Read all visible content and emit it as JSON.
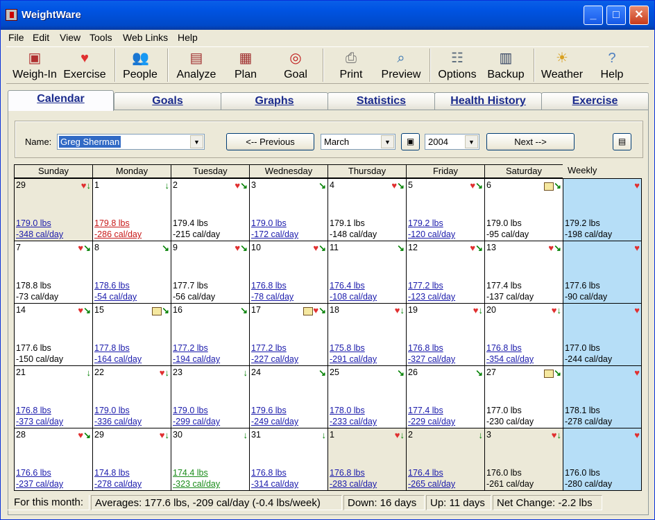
{
  "window": {
    "title": "WeightWare"
  },
  "menu": [
    "File",
    "Edit",
    "View",
    "Tools",
    "Web Links",
    "Help"
  ],
  "toolbar": [
    {
      "label": "Weigh-In",
      "icon": "scale-icon"
    },
    {
      "label": "Exercise",
      "icon": "heart-check-icon"
    },
    {
      "label": "People",
      "icon": "people-icon"
    },
    {
      "label": "Analyze",
      "icon": "analyze-icon"
    },
    {
      "label": "Plan",
      "icon": "plan-icon"
    },
    {
      "label": "Goal",
      "icon": "target-icon"
    },
    {
      "label": "Print",
      "icon": "printer-icon"
    },
    {
      "label": "Preview",
      "icon": "magnifier-icon"
    },
    {
      "label": "Options",
      "icon": "options-icon"
    },
    {
      "label": "Backup",
      "icon": "backup-icon"
    },
    {
      "label": "Weather",
      "icon": "sun-icon"
    },
    {
      "label": "Help",
      "icon": "help-icon"
    }
  ],
  "tabs": [
    "Calendar",
    "Goals",
    "Graphs",
    "Statistics",
    "Health History",
    "Exercise"
  ],
  "controls": {
    "name_label": "Name:",
    "name_value": "Greg Sherman",
    "prev_label": "<-- Previous",
    "month": "March",
    "year": "2004",
    "next_label": "Next -->"
  },
  "weekdays": [
    "Sunday",
    "Monday",
    "Tuesday",
    "Wednesday",
    "Thursday",
    "Friday",
    "Saturday",
    "Weekly"
  ],
  "weeks": [
    [
      {
        "day": "29",
        "weight": "179.0 lbs",
        "cal": "-348 cal/day",
        "style": "link",
        "other": true,
        "icons": [
          "heart",
          "down"
        ]
      },
      {
        "day": "1",
        "weight": "179.8 lbs",
        "cal": "-286 cal/day",
        "style": "red",
        "other": false,
        "icons": [
          "down"
        ]
      },
      {
        "day": "2",
        "weight": "179.4 lbs",
        "cal": "-215 cal/day",
        "style": "plain",
        "other": false,
        "icons": [
          "heart",
          "diag"
        ]
      },
      {
        "day": "3",
        "weight": "179.0 lbs",
        "cal": "-172 cal/day",
        "style": "link",
        "other": false,
        "icons": [
          "diag"
        ]
      },
      {
        "day": "4",
        "weight": "179.1 lbs",
        "cal": "-148 cal/day",
        "style": "plain",
        "other": false,
        "icons": [
          "heart",
          "diag"
        ]
      },
      {
        "day": "5",
        "weight": "179.2 lbs",
        "cal": "-120 cal/day",
        "style": "link",
        "other": false,
        "icons": [
          "heart",
          "diag"
        ]
      },
      {
        "day": "6",
        "weight": "179.0 lbs",
        "cal": "-95 cal/day",
        "style": "plain",
        "other": false,
        "icons": [
          "note",
          "diag"
        ]
      },
      {
        "weight": "179.2 lbs",
        "cal": "-198 cal/day",
        "weekly": true,
        "icons": [
          "heart"
        ]
      }
    ],
    [
      {
        "day": "7",
        "weight": "178.8 lbs",
        "cal": "-73 cal/day",
        "style": "plain",
        "other": false,
        "icons": [
          "heart",
          "diag"
        ]
      },
      {
        "day": "8",
        "weight": "178.6 lbs",
        "cal": "-54 cal/day",
        "style": "link",
        "other": false,
        "icons": [
          "diag"
        ]
      },
      {
        "day": "9",
        "weight": "177.7 lbs",
        "cal": "-56 cal/day",
        "style": "plain",
        "other": false,
        "icons": [
          "heart",
          "diag"
        ]
      },
      {
        "day": "10",
        "weight": "176.8 lbs",
        "cal": "-78 cal/day",
        "style": "link",
        "other": false,
        "icons": [
          "heart",
          "diag"
        ]
      },
      {
        "day": "11",
        "weight": "176.4 lbs",
        "cal": "-108 cal/day",
        "style": "link",
        "other": false,
        "icons": [
          "diag"
        ]
      },
      {
        "day": "12",
        "weight": "177.2 lbs",
        "cal": "-123 cal/day",
        "style": "link",
        "other": false,
        "icons": [
          "heart",
          "diag"
        ]
      },
      {
        "day": "13",
        "weight": "177.4 lbs",
        "cal": "-137 cal/day",
        "style": "plain",
        "other": false,
        "icons": [
          "heart",
          "diag"
        ]
      },
      {
        "weight": "177.6 lbs",
        "cal": "-90 cal/day",
        "weekly": true,
        "icons": [
          "heart"
        ]
      }
    ],
    [
      {
        "day": "14",
        "weight": "177.6 lbs",
        "cal": "-150 cal/day",
        "style": "plain",
        "other": false,
        "icons": [
          "heart",
          "diag"
        ]
      },
      {
        "day": "15",
        "weight": "177.8 lbs",
        "cal": "-164 cal/day",
        "style": "link",
        "other": false,
        "icons": [
          "note",
          "diag"
        ]
      },
      {
        "day": "16",
        "weight": "177.2 lbs",
        "cal": "-194 cal/day",
        "style": "link",
        "other": false,
        "icons": [
          "diag"
        ]
      },
      {
        "day": "17",
        "weight": "177.2 lbs",
        "cal": "-227 cal/day",
        "style": "link",
        "other": false,
        "icons": [
          "note",
          "heart",
          "diag"
        ]
      },
      {
        "day": "18",
        "weight": "175.8 lbs",
        "cal": "-291 cal/day",
        "style": "link",
        "other": false,
        "icons": [
          "heart",
          "down"
        ]
      },
      {
        "day": "19",
        "weight": "176.8 lbs",
        "cal": "-327 cal/day",
        "style": "link",
        "other": false,
        "icons": [
          "heart",
          "down"
        ]
      },
      {
        "day": "20",
        "weight": "176.8 lbs",
        "cal": "-354 cal/day",
        "style": "link",
        "other": false,
        "icons": [
          "heart",
          "down"
        ]
      },
      {
        "weight": "177.0 lbs",
        "cal": "-244 cal/day",
        "weekly": true,
        "icons": [
          "heart"
        ]
      }
    ],
    [
      {
        "day": "21",
        "weight": "176.8 lbs",
        "cal": "-373 cal/day",
        "style": "link",
        "other": false,
        "icons": [
          "down"
        ]
      },
      {
        "day": "22",
        "weight": "179.0 lbs",
        "cal": "-336 cal/day",
        "style": "link",
        "other": false,
        "icons": [
          "heart",
          "down"
        ]
      },
      {
        "day": "23",
        "weight": "179.0 lbs",
        "cal": "-299 cal/day",
        "style": "link",
        "other": false,
        "icons": [
          "down"
        ]
      },
      {
        "day": "24",
        "weight": "179.6 lbs",
        "cal": "-249 cal/day",
        "style": "link",
        "other": false,
        "icons": [
          "diag"
        ]
      },
      {
        "day": "25",
        "weight": "178.0 lbs",
        "cal": "-233 cal/day",
        "style": "link",
        "other": false,
        "icons": [
          "diag"
        ]
      },
      {
        "day": "26",
        "weight": "177.4 lbs",
        "cal": "-229 cal/day",
        "style": "link",
        "other": false,
        "icons": [
          "diag"
        ]
      },
      {
        "day": "27",
        "weight": "177.0 lbs",
        "cal": "-230 cal/day",
        "style": "plain",
        "other": false,
        "icons": [
          "note",
          "diag"
        ]
      },
      {
        "weight": "178.1 lbs",
        "cal": "-278 cal/day",
        "weekly": true,
        "icons": [
          "heart"
        ]
      }
    ],
    [
      {
        "day": "28",
        "weight": "176.6 lbs",
        "cal": "-237 cal/day",
        "style": "link",
        "other": false,
        "icons": [
          "heart",
          "diag"
        ]
      },
      {
        "day": "29",
        "weight": "174.8 lbs",
        "cal": "-278 cal/day",
        "style": "link",
        "other": false,
        "icons": [
          "heart",
          "down"
        ]
      },
      {
        "day": "30",
        "weight": "174.4 lbs",
        "cal": "-323 cal/day",
        "style": "green",
        "other": false,
        "icons": [
          "down"
        ]
      },
      {
        "day": "31",
        "weight": "176.8 lbs",
        "cal": "-314 cal/day",
        "style": "link",
        "other": false,
        "icons": [
          "down"
        ]
      },
      {
        "day": "1",
        "weight": "176.8 lbs",
        "cal": "-283 cal/day",
        "style": "link",
        "other": true,
        "icons": [
          "heart",
          "down"
        ]
      },
      {
        "day": "2",
        "weight": "176.4 lbs",
        "cal": "-265 cal/day",
        "style": "link",
        "other": true,
        "icons": [
          "down"
        ]
      },
      {
        "day": "3",
        "weight": "176.0 lbs",
        "cal": "-261 cal/day",
        "style": "plain",
        "other": true,
        "icons": [
          "heart",
          "down"
        ]
      },
      {
        "weight": "176.0 lbs",
        "cal": "-280 cal/day",
        "weekly": true,
        "icons": [
          "heart"
        ]
      }
    ]
  ],
  "status": {
    "label": "For this month:",
    "averages": "Averages: 177.6 lbs, -209 cal/day (-0.4 lbs/week)",
    "down": "Down: 16 days",
    "up": "Up: 11 days",
    "net": "Net Change: -2.2 lbs"
  },
  "colors": {
    "weekly_bg": "#b6def7",
    "other_month_bg": "#ece9d8",
    "link": "#1a1aab",
    "high": "#c81818",
    "low": "#1a8c1a"
  }
}
